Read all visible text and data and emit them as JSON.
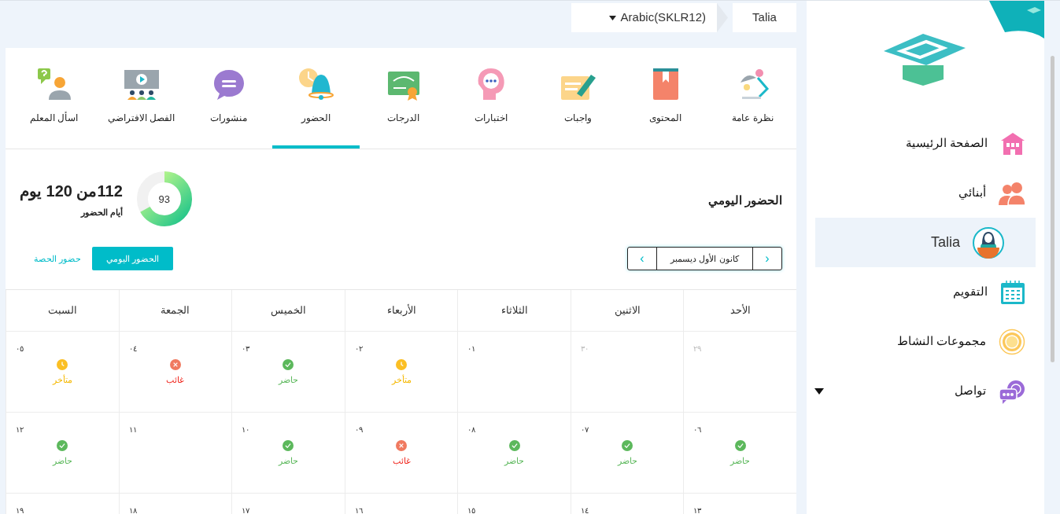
{
  "breadcrumb": {
    "language": "Arabic(SKLR12)",
    "student": "Talia"
  },
  "tabs": [
    {
      "label": "نظرة عامة",
      "selected": false
    },
    {
      "label": "المحتوى",
      "selected": false
    },
    {
      "label": "واجبات",
      "selected": false
    },
    {
      "label": "اختبارات",
      "selected": false
    },
    {
      "label": "الدرجات",
      "selected": false
    },
    {
      "label": "الحضور",
      "selected": true
    },
    {
      "label": "منشورات",
      "selected": false
    },
    {
      "label": "الفصل الافتراضي",
      "selected": false
    },
    {
      "label": "اسأل المعلم",
      "selected": false
    }
  ],
  "summary": {
    "title": "الحضور اليومي",
    "percent": "93",
    "level": 0.67,
    "count": "112من 120 يوم",
    "caption": "أيام الحضور"
  },
  "month_picker": {
    "prev": "‹",
    "month": "كانون الأول ديسمبر",
    "next": "›"
  },
  "view_toggle": [
    {
      "label": "الحضور اليومي",
      "selected": true
    },
    {
      "label": "حضور الحصة",
      "selected": false
    }
  ],
  "calendar": {
    "weekdays": [
      "الأحد",
      "الاثنين",
      "الثلاثاء",
      "الأربعاء",
      "الخميس",
      "الجمعة",
      "السبت"
    ],
    "weeks": [
      [
        {
          "day": "٢٩",
          "muted": true
        },
        {
          "day": "٣٠",
          "muted": true
        },
        {
          "day": "٠١",
          "muted": false
        },
        {
          "day": "٠٢",
          "muted": false,
          "kind": "late",
          "status": "متأخر"
        },
        {
          "day": "٠٣",
          "muted": false,
          "kind": "present",
          "status": "حاضر"
        },
        {
          "day": "٠٤",
          "muted": false,
          "kind": "absent",
          "status": "غائب"
        },
        {
          "day": "٠٥",
          "muted": false,
          "kind": "late",
          "status": "متأخر"
        }
      ],
      [
        {
          "day": "٠٦",
          "muted": false,
          "kind": "present",
          "status": "حاضر"
        },
        {
          "day": "٠٧",
          "muted": false,
          "kind": "present",
          "status": "حاضر"
        },
        {
          "day": "٠٨",
          "muted": false,
          "kind": "present",
          "status": "حاضر"
        },
        {
          "day": "٠٩",
          "muted": false,
          "kind": "absent",
          "status": "غائب"
        },
        {
          "day": "١٠",
          "muted": false,
          "kind": "present",
          "status": "حاضر"
        },
        {
          "day": "١١",
          "muted": false
        },
        {
          "day": "١٢",
          "muted": false,
          "kind": "present",
          "status": "حاضر"
        }
      ],
      [
        {
          "day": "١٣",
          "muted": false
        },
        {
          "day": "١٤",
          "muted": false
        },
        {
          "day": "١٥",
          "muted": false
        },
        {
          "day": "١٦",
          "muted": false
        },
        {
          "day": "١٧",
          "muted": false
        },
        {
          "day": "١٨",
          "muted": false
        },
        {
          "day": "١٩",
          "muted": false
        }
      ]
    ]
  },
  "sidebar": {
    "items": [
      {
        "label": "الصفحة الرئيسية",
        "selected": false
      },
      {
        "label": "أبنائي",
        "selected": false
      },
      {
        "label": "Talia",
        "selected": true
      },
      {
        "label": "التقويم",
        "selected": false
      },
      {
        "label": "مجموعات النشاط",
        "selected": false
      },
      {
        "label": "تواصل",
        "selected": false,
        "expandable": true
      }
    ]
  }
}
